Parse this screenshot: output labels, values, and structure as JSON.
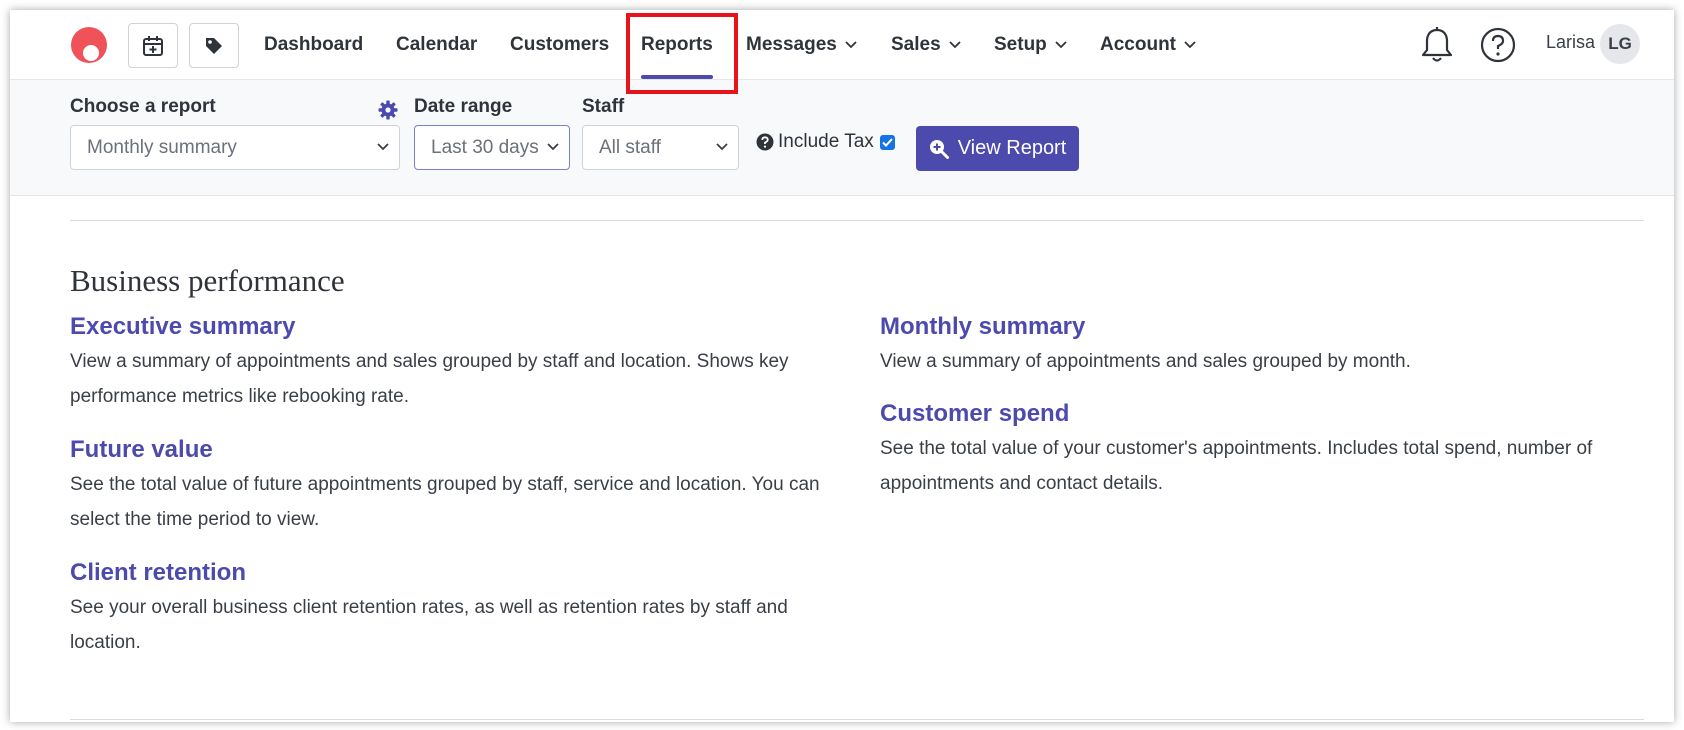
{
  "nav": {
    "items": [
      {
        "label": "Dashboard",
        "dropdown": false
      },
      {
        "label": "Calendar",
        "dropdown": false
      },
      {
        "label": "Customers",
        "dropdown": false
      },
      {
        "label": "Reports",
        "dropdown": false,
        "active": true
      },
      {
        "label": "Messages",
        "dropdown": true
      },
      {
        "label": "Sales",
        "dropdown": true
      },
      {
        "label": "Setup",
        "dropdown": true
      },
      {
        "label": "Account",
        "dropdown": true
      }
    ],
    "user": {
      "name": "Larisa",
      "initials": "LG"
    },
    "accent_color": "#4c4aad",
    "brand_color": "#f0525a",
    "highlight_color": "#e8141c"
  },
  "filters": {
    "report": {
      "label": "Choose a report",
      "value": "Monthly summary"
    },
    "date_range": {
      "label": "Date range",
      "value": "Last 30 days"
    },
    "staff": {
      "label": "Staff",
      "value": "All staff"
    },
    "include_tax": {
      "label": "Include Tax",
      "checked": true
    },
    "view_button": "View Report"
  },
  "main": {
    "section_title": "Business performance",
    "reports_left": [
      {
        "title": "Executive summary",
        "description": "View a summary of appointments and sales grouped by staff and location. Shows key performance metrics like rebooking rate."
      },
      {
        "title": "Future value",
        "description": "See the total value of future appointments grouped by staff, service and location. You can select the time period to view."
      },
      {
        "title": "Client retention",
        "description": "See your overall business client retention rates, as well as retention rates by staff and location."
      }
    ],
    "reports_right": [
      {
        "title": "Monthly summary",
        "description": "View a summary of appointments and sales grouped by month."
      },
      {
        "title": "Customer spend",
        "description": "See the total value of your customer's appointments. Includes total spend, number of appointments and contact details."
      }
    ]
  }
}
